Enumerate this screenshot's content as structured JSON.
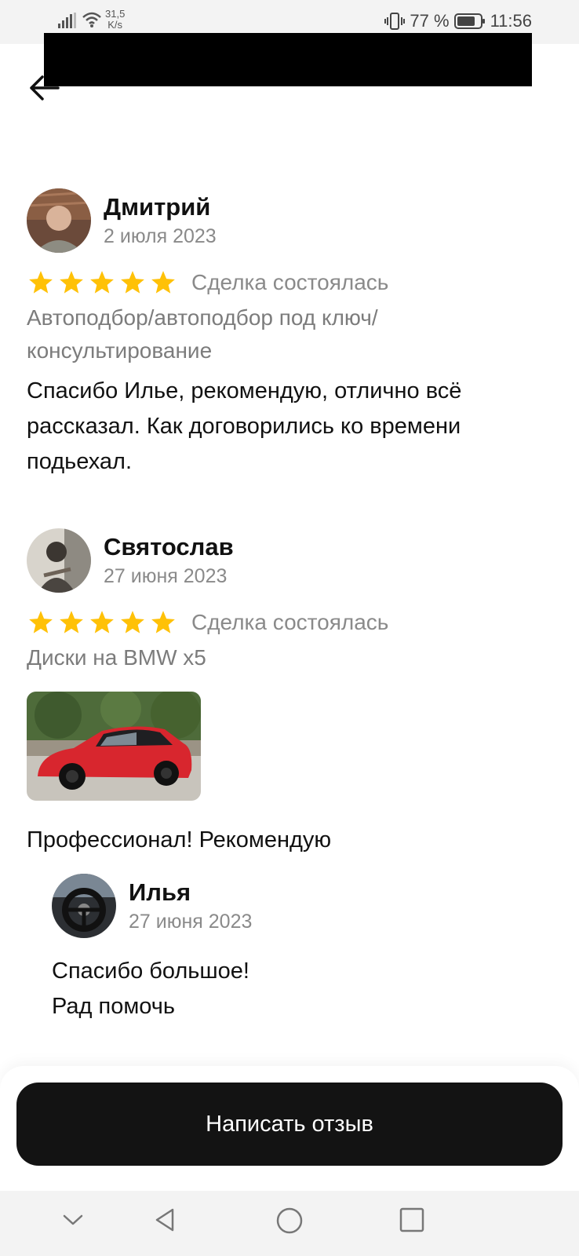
{
  "status_bar": {
    "net_speed_value": "31,5",
    "net_speed_unit": "K/s",
    "battery": "77 %",
    "time": "11:56"
  },
  "reviews": [
    {
      "name": "Дмитрий",
      "date": "2 июля 2023",
      "stars": 5,
      "status": "Сделка состоялась",
      "service": "Автоподбор/автоподбор под ключ/ консультирование",
      "text": "Спасибо Илье, рекомендую, отлично всё рассказал. Как договорились ко времени подьехал."
    },
    {
      "name": "Святослав",
      "date": "27 июня 2023",
      "stars": 5,
      "status": "Сделка состоялась",
      "service": "Диски на BMW x5",
      "text": "Профессионал! Рекомендую",
      "reply": {
        "name": "Илья",
        "date": "27 июня 2023",
        "text_line1": "Спасибо большое!",
        "text_line2": "Рад помочь"
      }
    }
  ],
  "cta_label": "Написать отзыв",
  "colors": {
    "star": "#FFC107",
    "button_bg": "#131313",
    "muted_text": "#8a8a8a"
  }
}
